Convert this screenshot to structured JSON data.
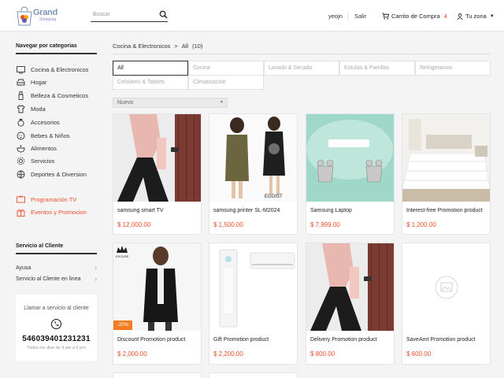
{
  "header": {
    "logo_text": "Grand",
    "logo_sub": "Shopping",
    "search_placeholder": "Buscar",
    "user": "yeojn",
    "logout": "Salir",
    "cart_label": "Carrito de Compra",
    "cart_count": "4",
    "zone_label": "Tu zona"
  },
  "sidebar": {
    "categories_title": "Navegar por categorias",
    "categories": [
      {
        "label": "Cocina & Electronicos",
        "icon": "tv-icon"
      },
      {
        "label": "Hogar",
        "icon": "sofa-icon"
      },
      {
        "label": "Belleza & Cosmeticos",
        "icon": "cosmetics-icon"
      },
      {
        "label": "Moda",
        "icon": "shirt-icon"
      },
      {
        "label": "Accesorios",
        "icon": "ring-icon"
      },
      {
        "label": "Bebes & Niños",
        "icon": "baby-icon"
      },
      {
        "label": "Alimentos",
        "icon": "food-icon"
      },
      {
        "label": "Servicios",
        "icon": "gear-icon"
      },
      {
        "label": "Deportes & Diversion",
        "icon": "sports-icon"
      }
    ],
    "special": [
      {
        "label": "Programación TV",
        "icon": "tv-icon"
      },
      {
        "label": "Eventos y Promocion",
        "icon": "gift-icon"
      }
    ],
    "service_title": "Servicio al Cliente",
    "service_items": [
      {
        "label": "Ayusa"
      },
      {
        "label": "Servicio al Cliente en linea"
      }
    ],
    "call": {
      "title": "Llamar a servicio al cliente",
      "number": "546039401231231",
      "hours": "Todos los dias de 9 am a 6 pm"
    }
  },
  "breadcrumb": {
    "category": "Cocina & Electronicos",
    "current": "All",
    "count": "(10)"
  },
  "tabs": [
    "All",
    "Cocina",
    "Lavado & Secado",
    "Estufas & Parrillas",
    "Refrigeracion",
    "Celulares & Tablets",
    "Climatizacion"
  ],
  "active_tab": "All",
  "sort": {
    "selected": "Nuevo"
  },
  "products": [
    {
      "name": "samsung smart TV",
      "price": "$ 12,000.00"
    },
    {
      "name": "samsung printer SL-M2024",
      "price": "$ 1,500.00"
    },
    {
      "name": "Samsung Laptop",
      "price": "$ 7,999.00"
    },
    {
      "name": "Interest-free Promotion product",
      "price": "$ 1,200.00"
    },
    {
      "name": "Discount Promotion product",
      "price": "$ 2,000.00",
      "badge": "-20%"
    },
    {
      "name": "Gift Promotion product",
      "price": "$ 2,200.00"
    },
    {
      "name": "Delivery Promotion product",
      "price": "$ 800.00"
    },
    {
      "name": "SaveAmt Promotion product",
      "price": "$ 600.00"
    }
  ],
  "colors": {
    "accent": "#e84e2a",
    "badge": "#f47b20",
    "logo": "#7a94b8"
  }
}
